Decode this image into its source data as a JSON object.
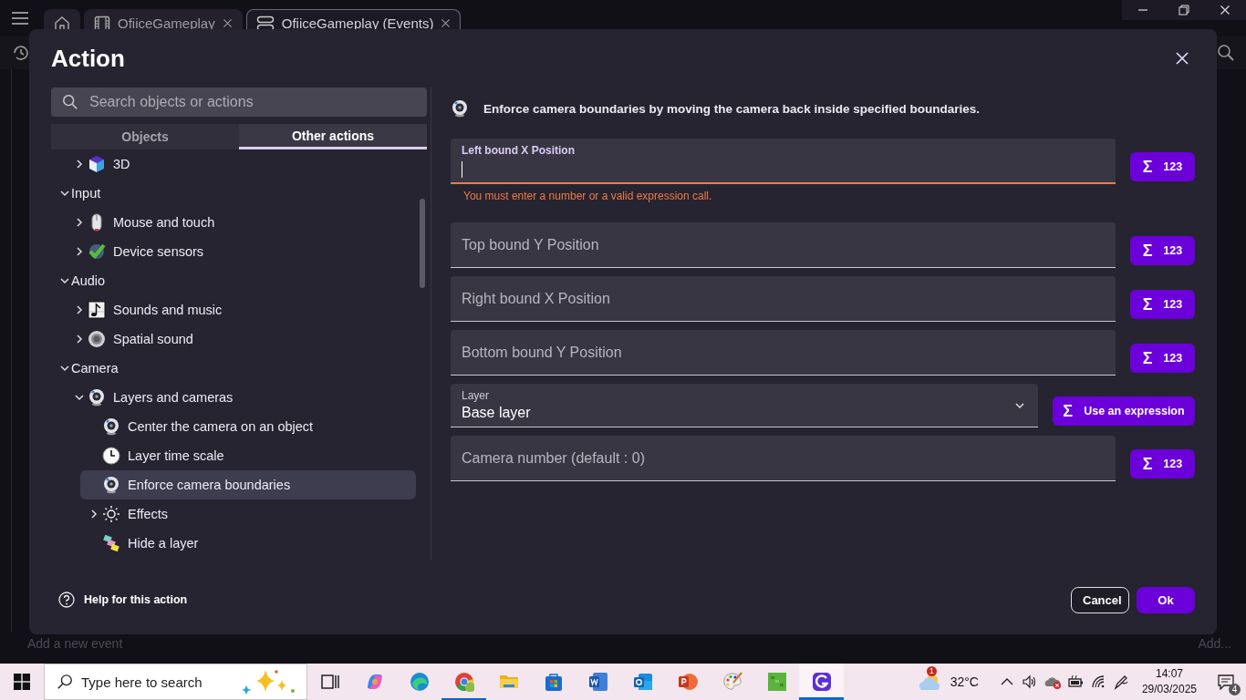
{
  "app": {
    "tabs": [
      {
        "kind": "home",
        "selected": false
      },
      {
        "kind": "scene",
        "label": "OfiiceGameplay",
        "selected": false
      },
      {
        "kind": "events",
        "label": "OfiiceGameplay (Events)",
        "selected": true
      }
    ],
    "add_event": "Add a new event",
    "add_other": "Add..."
  },
  "dialog": {
    "title": "Action",
    "search": {
      "placeholder": "Search objects or actions"
    },
    "tabs": [
      {
        "label": "Objects",
        "selected": false
      },
      {
        "label": "Other actions",
        "selected": true
      }
    ],
    "tree": [
      {
        "children": [
          {
            "label": "3D",
            "kind": "cube",
            "expanded": false,
            "selected": false
          }
        ]
      },
      {
        "label": "Input",
        "expanded": true,
        "selected": false,
        "children": [
          {
            "label": "Mouse and touch",
            "kind": "mouse",
            "expanded": false,
            "selected": false
          },
          {
            "label": "Device sensors",
            "kind": "sensors",
            "expanded": false,
            "selected": false
          }
        ]
      },
      {
        "label": "Audio",
        "expanded": true,
        "selected": false,
        "children": [
          {
            "label": "Sounds and music",
            "kind": "note",
            "expanded": false,
            "selected": false
          },
          {
            "label": "Spatial sound",
            "kind": "speaker",
            "expanded": false,
            "selected": false
          }
        ]
      },
      {
        "label": "Camera",
        "expanded": true,
        "selected": false,
        "children": [
          {
            "label": "Layers and cameras",
            "kind": "webcam",
            "expanded": true,
            "selected": false,
            "children": [
              {
                "label": "Center the camera on an object",
                "kind": "webcam",
                "selected": false
              },
              {
                "label": "Layer time scale",
                "kind": "clock",
                "selected": false
              },
              {
                "label": "Enforce camera boundaries",
                "kind": "webcam",
                "selected": true
              },
              {
                "label": "Effects",
                "kind": "sun",
                "expanded": false,
                "selected": false
              },
              {
                "label": "Hide a layer",
                "kind": "layers",
                "selected": false
              }
            ]
          }
        ]
      }
    ],
    "description": "Enforce camera boundaries by moving the camera back inside specified boundaries.",
    "params": [
      {
        "kind": "number",
        "label": "Left bound X Position",
        "focused": true,
        "error": "You must enter a number or a valid expression call.",
        "button": {
          "symbol": "Σ",
          "label": "123"
        }
      },
      {
        "kind": "number",
        "label": "Top bound Y Position",
        "focused": false,
        "button": {
          "symbol": "Σ",
          "label": "123"
        }
      },
      {
        "kind": "number",
        "label": "Right bound X Position",
        "focused": false,
        "button": {
          "symbol": "Σ",
          "label": "123"
        }
      },
      {
        "kind": "number",
        "label": "Bottom bound Y Position",
        "focused": false,
        "button": {
          "symbol": "Σ",
          "label": "123"
        }
      },
      {
        "kind": "select",
        "label": "Layer",
        "value": "Base layer",
        "button": {
          "symbol": "Σ",
          "label": "Use an expression"
        }
      },
      {
        "kind": "number",
        "label": "Camera number (default : 0)",
        "focused": false,
        "button": {
          "symbol": "Σ",
          "label": "123"
        }
      }
    ],
    "help": "Help for this action",
    "buttons": [
      {
        "label": "Cancel",
        "kind": "secondary"
      },
      {
        "label": "Ok",
        "kind": "primary"
      }
    ]
  },
  "taskbar": {
    "search": {
      "placeholder": "Type here to search"
    },
    "apps": [
      {
        "kind": "taskview",
        "running": false,
        "selected": false
      },
      {
        "kind": "swirl",
        "running": false,
        "selected": false
      },
      {
        "kind": "wave",
        "running": false,
        "selected": false
      },
      {
        "kind": "browser",
        "running": true,
        "selected": false
      },
      {
        "kind": "folder",
        "running": false,
        "selected": false
      },
      {
        "kind": "bag",
        "running": false,
        "selected": false
      },
      {
        "kind": "doc",
        "running": false,
        "selected": false
      },
      {
        "kind": "mail",
        "running": false,
        "selected": false
      },
      {
        "kind": "slides",
        "running": false,
        "selected": false
      },
      {
        "kind": "palette",
        "running": false,
        "selected": false
      },
      {
        "kind": "block",
        "running": false,
        "selected": false
      },
      {
        "kind": "logo",
        "running": true,
        "selected": true
      }
    ],
    "weather": {
      "badge": "1",
      "temp": "32°C"
    },
    "time": "14:07",
    "date": "29/03/2025",
    "notifications": "4"
  }
}
